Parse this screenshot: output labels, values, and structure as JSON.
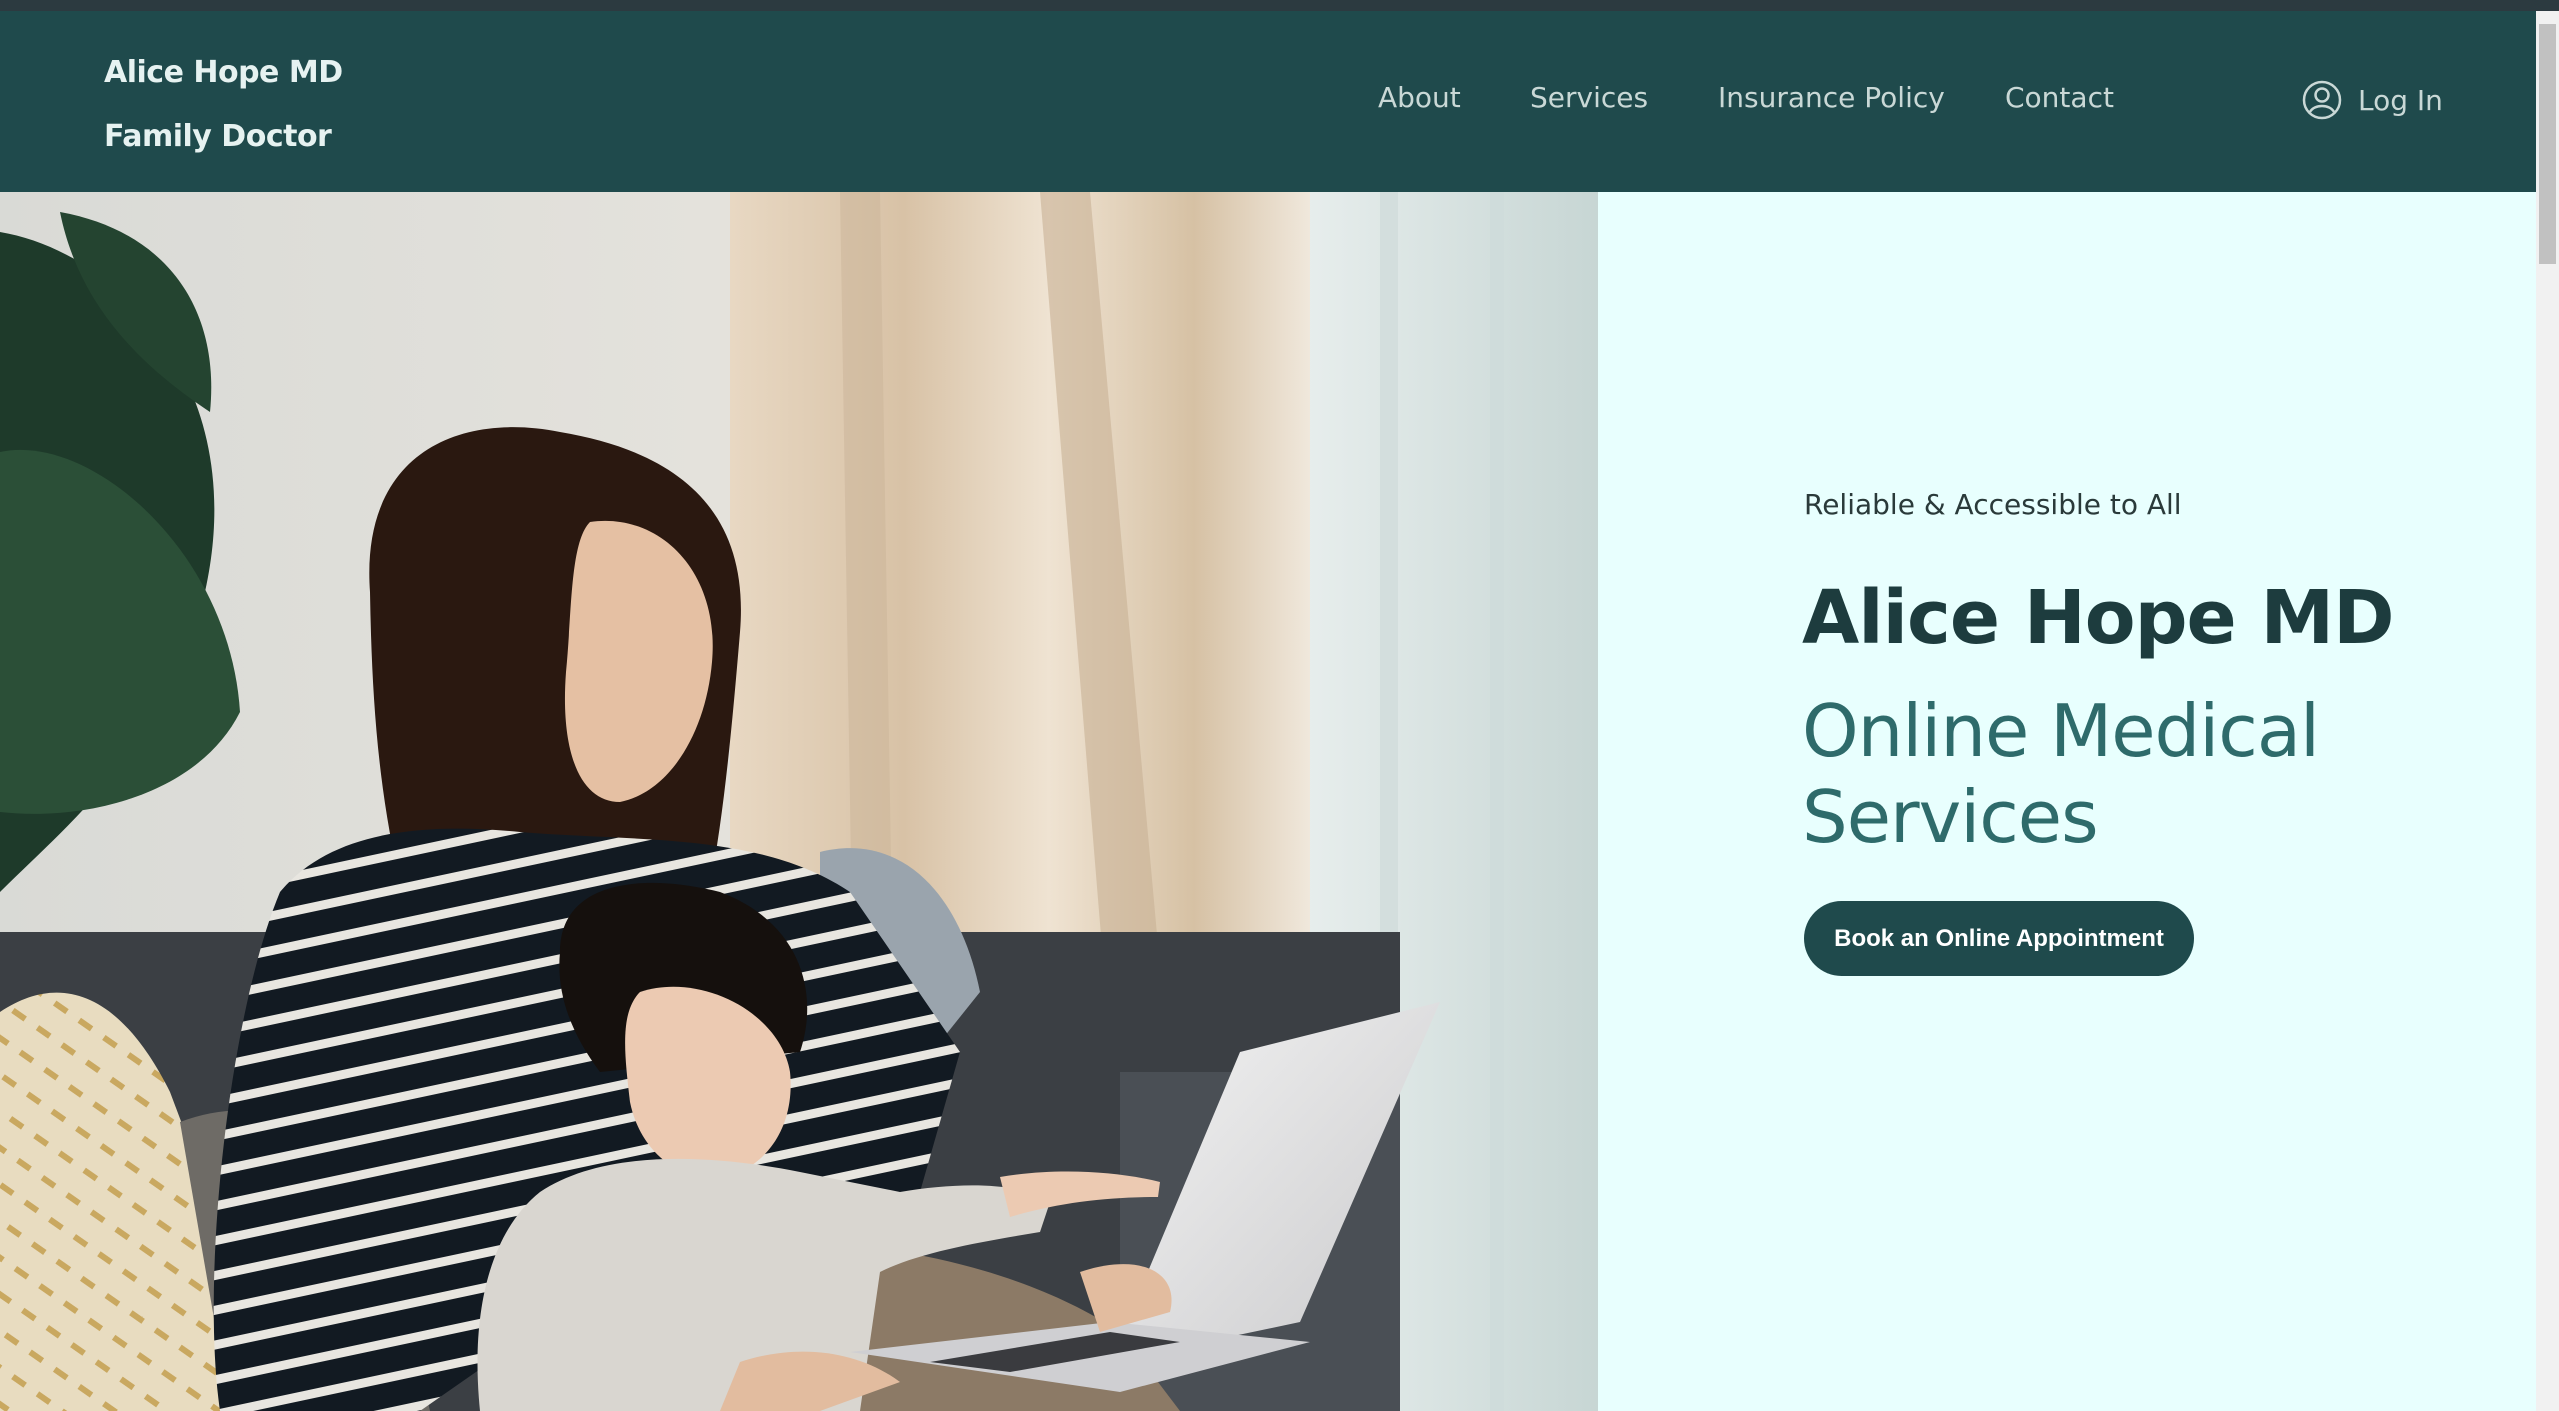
{
  "header": {
    "brand_line1": "Alice Hope MD",
    "brand_line2": "Family Doctor",
    "nav": [
      {
        "label": "About"
      },
      {
        "label": "Services"
      },
      {
        "label": "Insurance Policy"
      },
      {
        "label": "Contact"
      }
    ],
    "login_label": "Log In",
    "login_icon": "user-circle-icon"
  },
  "hero": {
    "image_alt": "Mother and young child using a laptop on a couch",
    "tagline": "Reliable & Accessible to All",
    "title": "Alice Hope MD",
    "subtitle": "Online Medical Services",
    "cta_label": "Book an Online Appointment"
  },
  "colors": {
    "header_bg": "#1f4a4c",
    "panel_bg": "#e8fffe",
    "title": "#1d3c3e",
    "subtitle": "#2e6b6b",
    "button_bg": "#1f4a4c"
  }
}
